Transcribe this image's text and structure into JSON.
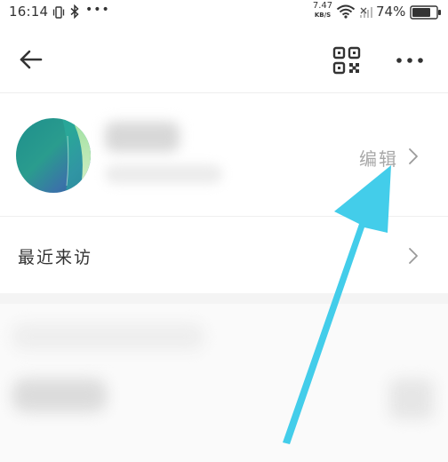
{
  "status_bar": {
    "time": "16:14",
    "dots": "•••",
    "net_speed_value": "7.47",
    "net_speed_unit": "KB/S",
    "battery_percent": "74%",
    "icons": [
      "vibrate-icon",
      "bluetooth-icon",
      "wifi-icon",
      "signal-icon",
      "battery-icon"
    ]
  },
  "top_bar": {
    "icons": [
      "back-arrow-icon",
      "qr-code-icon",
      "more-icon"
    ]
  },
  "profile": {
    "edit_label": "编辑"
  },
  "menu": {
    "recent_visitors_label": "最近来访"
  },
  "annotation": {
    "arrow_color": "#43cdea"
  },
  "colors": {
    "background": "#ffffff",
    "divider": "#eeeeee",
    "muted_text": "#a8a8a8",
    "primary_text": "#333333"
  }
}
